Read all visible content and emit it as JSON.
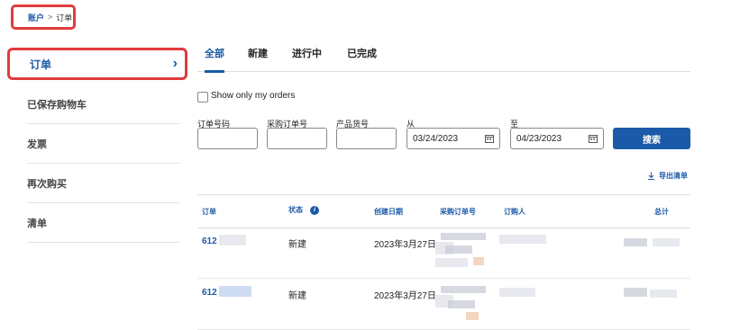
{
  "breadcrumb": {
    "account": "账户",
    "separator": ">",
    "current": "订单"
  },
  "sidebar": {
    "active": "订单",
    "items": [
      {
        "label": "已保存购物车"
      },
      {
        "label": "发票"
      },
      {
        "label": "再次购买"
      },
      {
        "label": "清单"
      }
    ]
  },
  "tabs": [
    {
      "label": "全部"
    },
    {
      "label": "新建"
    },
    {
      "label": "进行中"
    },
    {
      "label": "已完成"
    }
  ],
  "filters": {
    "show_only_mine": "Show only my orders",
    "order_number_label": "订单号码",
    "po_number_label": "采购订单号",
    "product_number_label": "产品货号",
    "from_label": "从",
    "from_value": "03/24/2023",
    "to_label": "至",
    "to_value": "04/23/2023",
    "search_button": "搜索"
  },
  "export_label": "导出清单",
  "table": {
    "headers": {
      "order": "订单",
      "status": "状态",
      "created": "创建日期",
      "po": "采购订单号",
      "buyer": "订购人",
      "total": "总计"
    },
    "rows": [
      {
        "order": "612",
        "status": "新建",
        "created": "2023年3月27日"
      },
      {
        "order": "612",
        "status": "新建",
        "created": "2023年3月27日"
      }
    ]
  },
  "colors": {
    "accent": "#1b5aa8",
    "highlight": "#e03b3b"
  }
}
